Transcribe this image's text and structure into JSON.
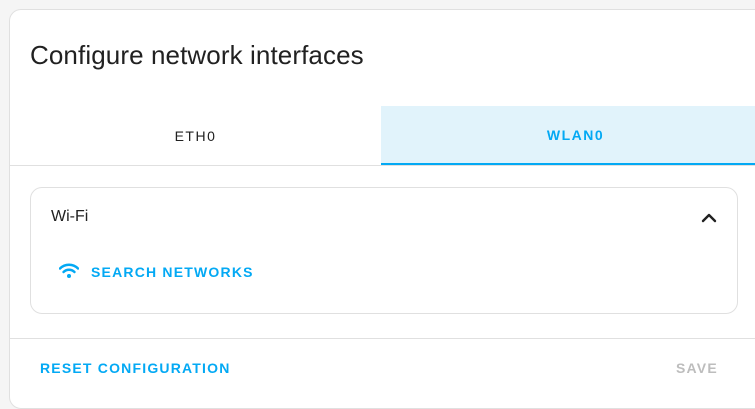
{
  "dialog": {
    "title": "Configure network interfaces"
  },
  "tabs": [
    {
      "label": "ETH0",
      "active": false
    },
    {
      "label": "WLAN0",
      "active": true
    }
  ],
  "wifi_panel": {
    "title": "Wi-Fi",
    "expanded": true,
    "search_label": "SEARCH NETWORKS"
  },
  "actions": {
    "reset_label": "RESET CONFIGURATION",
    "save_label": "SAVE",
    "save_enabled": false
  },
  "colors": {
    "accent": "#03a9f4",
    "active_tab_bg": "#e1f3fb",
    "disabled_text": "#bdbdbd"
  }
}
